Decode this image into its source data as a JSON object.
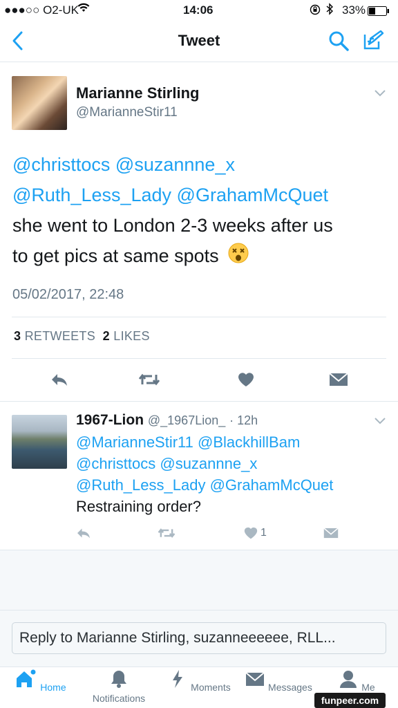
{
  "status_bar": {
    "carrier": "●●●○○ O2-UK",
    "time": "14:06",
    "battery": "33%"
  },
  "nav": {
    "title": "Tweet"
  },
  "tweet": {
    "author_name": "Marianne Stirling",
    "author_handle": "@MarianneStir11",
    "mention_line1": "@christtocs @suzannne_x",
    "mention_line2": "@Ruth_Less_Lady @GrahamMcQuet",
    "body_line1": "she went to London 2-3 weeks after us",
    "body_line2": "to get pics at same spots",
    "timestamp": "05/02/2017, 22:48",
    "retweets_count": "3",
    "retweets_label": "RETWEETS",
    "likes_count": "2",
    "likes_label": "LIKES"
  },
  "reply": {
    "author_name": "1967-Lion",
    "author_handle": "@_1967Lion_",
    "time": "· 12h",
    "mention_line1": "@MarianneStir11 @BlackhillBam",
    "mention_line2": "@christtocs @suzannne_x",
    "mention_line3": "@Ruth_Less_Lady @GrahamMcQuet",
    "body": "Restraining order?",
    "likes_count": "1"
  },
  "reply_box": {
    "placeholder": "Reply to Marianne Stirling, suzanneeeeee, RLL..."
  },
  "tabs": [
    {
      "label": "Home"
    },
    {
      "label": "Notifications"
    },
    {
      "label": "Moments"
    },
    {
      "label": "Messages"
    },
    {
      "label": "Me"
    }
  ],
  "watermark": "funpeer.com",
  "colors": {
    "accent": "#1da1f2",
    "text": "#14171a",
    "secondary": "#657786",
    "divider": "#e1e8ed"
  }
}
